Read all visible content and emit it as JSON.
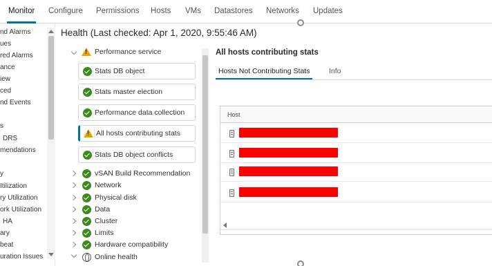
{
  "top_tabs": [
    "Monitor",
    "Configure",
    "Permissions",
    "Hosts",
    "VMs",
    "Datastores",
    "Networks",
    "Updates"
  ],
  "left_nav": {
    "items": [
      "nd Alarms",
      "ues",
      "red Alarms",
      "ance",
      "iew",
      "ced",
      "nd Events",
      "s",
      "DRS",
      "mendations",
      "y",
      "Itilization",
      "ry Utilization",
      "ork Utilization",
      "HA",
      "ary",
      "beat",
      "uration Issues"
    ]
  },
  "health": {
    "title": "Health (Last checked: Apr 1, 2020, 9:55:46 AM)",
    "expanded_group": "Performance service",
    "sub_items": [
      {
        "label": "Stats DB object",
        "status": "ok"
      },
      {
        "label": "Stats master election",
        "status": "ok"
      },
      {
        "label": "Performance data collection",
        "status": "ok"
      },
      {
        "label": "All hosts contributing stats",
        "status": "warning"
      },
      {
        "label": "Stats DB object conflicts",
        "status": "ok"
      }
    ],
    "groups": [
      {
        "label": "vSAN Build Recommendation",
        "status": "ok"
      },
      {
        "label": "Network",
        "status": "ok"
      },
      {
        "label": "Physical disk",
        "status": "ok"
      },
      {
        "label": "Data",
        "status": "ok"
      },
      {
        "label": "Cluster",
        "status": "ok"
      },
      {
        "label": "Limits",
        "status": "ok"
      },
      {
        "label": "Hardware compatibility",
        "status": "ok"
      },
      {
        "label": "Online health",
        "status": "online"
      }
    ]
  },
  "detail": {
    "title": "All hosts contributing stats",
    "tabs": [
      "Hosts Not Contributing Stats",
      "Info"
    ],
    "grid": {
      "column": "Host",
      "rows": [
        "",
        "",
        "",
        ""
      ]
    }
  },
  "colors": {
    "accent": "#0072a3",
    "ok": "#3c8a1e",
    "warning": "#e5a400",
    "redaction": "#ff0000"
  }
}
